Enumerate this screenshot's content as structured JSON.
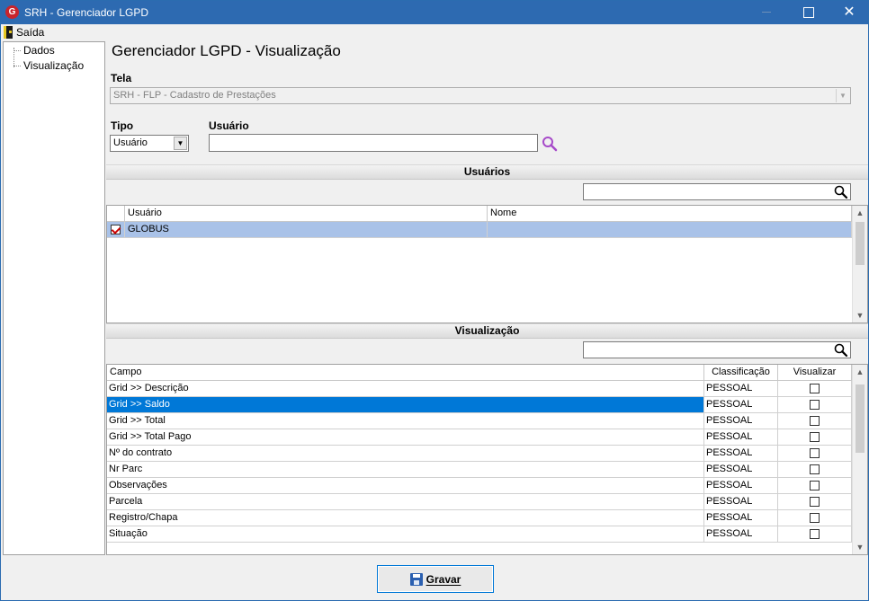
{
  "window": {
    "title": "SRH - Gerenciador LGPD",
    "app_icon_letter": "G",
    "close_glyph": "✕"
  },
  "menu": {
    "exit_label": "Saída"
  },
  "tree": {
    "items": [
      {
        "label": "Dados"
      },
      {
        "label": "Visualização"
      }
    ]
  },
  "main": {
    "page_title": "Gerenciador LGPD - Visualização",
    "tela_label": "Tela",
    "tela_value": "SRH - FLP - Cadastro de Prestações",
    "tipo_label": "Tipo",
    "tipo_value": "Usuário",
    "usuario_label": "Usuário",
    "usuario_value": ""
  },
  "usuarios_section": {
    "title": "Usuários",
    "filter_value": "",
    "columns": [
      "Usuário",
      "Nome"
    ],
    "rows": [
      {
        "checked": true,
        "usuario": "GLOBUS",
        "nome": ""
      }
    ]
  },
  "visualizacao_section": {
    "title": "Visualização",
    "filter_value": "",
    "columns": [
      "Campo",
      "Classificação",
      "Visualizar"
    ],
    "rows": [
      {
        "campo": "Grid >> Descrição",
        "classificacao": "PESSOAL",
        "visualizar": false
      },
      {
        "campo": "Grid >> Saldo",
        "classificacao": "PESSOAL",
        "visualizar": false
      },
      {
        "campo": "Grid >> Total",
        "classificacao": "PESSOAL",
        "visualizar": false
      },
      {
        "campo": "Grid >> Total Pago",
        "classificacao": "PESSOAL",
        "visualizar": false
      },
      {
        "campo": "Nº do contrato",
        "classificacao": "PESSOAL",
        "visualizar": false
      },
      {
        "campo": "Nr Parc",
        "classificacao": "PESSOAL",
        "visualizar": false
      },
      {
        "campo": "Observações",
        "classificacao": "PESSOAL",
        "visualizar": false
      },
      {
        "campo": "Parcela",
        "classificacao": "PESSOAL",
        "visualizar": false
      },
      {
        "campo": "Registro/Chapa",
        "classificacao": "PESSOAL",
        "visualizar": false
      },
      {
        "campo": "Situação",
        "classificacao": "PESSOAL",
        "visualizar": false
      }
    ],
    "selected_row": 1
  },
  "footer": {
    "save_label": "Gravar"
  },
  "colors": {
    "titlebar": "#2d6ab1",
    "selection_dark": "#0078d7",
    "selection_light": "#a9c2e8",
    "search_icon_purple": "#a64ac9"
  },
  "icons": {
    "app": "globus-logo-icon",
    "exit": "exit-door-icon",
    "search_user": "search-icon",
    "filter": "magnifier-icon",
    "save": "floppy-disk-icon"
  }
}
